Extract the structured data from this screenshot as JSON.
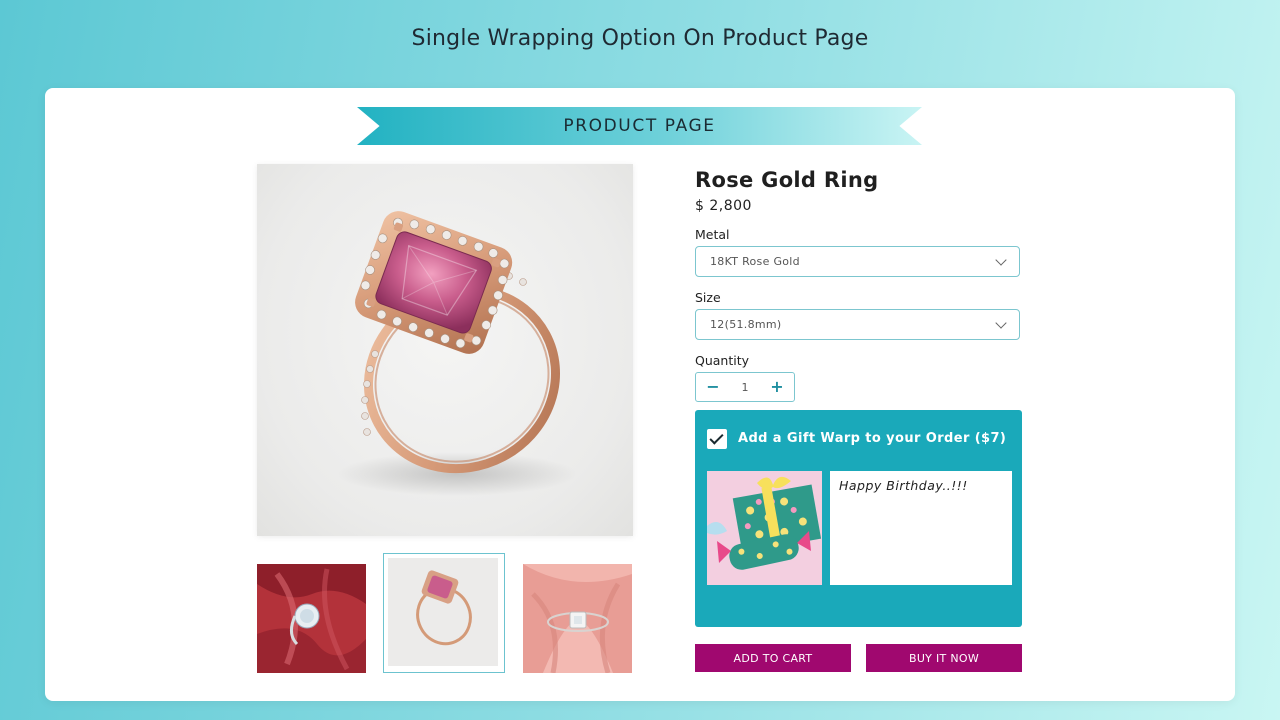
{
  "page_title": "Single Wrapping Option On Product Page",
  "banner": {
    "label": "PRODUCT PAGE"
  },
  "product": {
    "title": "Rose Gold Ring",
    "price": "$ 2,800",
    "metal": {
      "label": "Metal",
      "value": "18KT Rose Gold"
    },
    "size": {
      "label": "Size",
      "value": "12(51.8mm)"
    },
    "quantity": {
      "label": "Quantity",
      "value": "1",
      "minus": "−",
      "plus": "+"
    }
  },
  "gift": {
    "checked": true,
    "label": "Add a Gift Warp to your Order ($7)",
    "message": "Happy Birthday..!!!"
  },
  "actions": {
    "add_to_cart": "ADD TO CART",
    "buy_now": "BUY IT NOW"
  },
  "gallery": {
    "selected_index": 1,
    "thumbnail_count": 3
  },
  "colors": {
    "accent": "#1aa9ba",
    "button": "#a0086f",
    "border": "#7cc6cf"
  }
}
